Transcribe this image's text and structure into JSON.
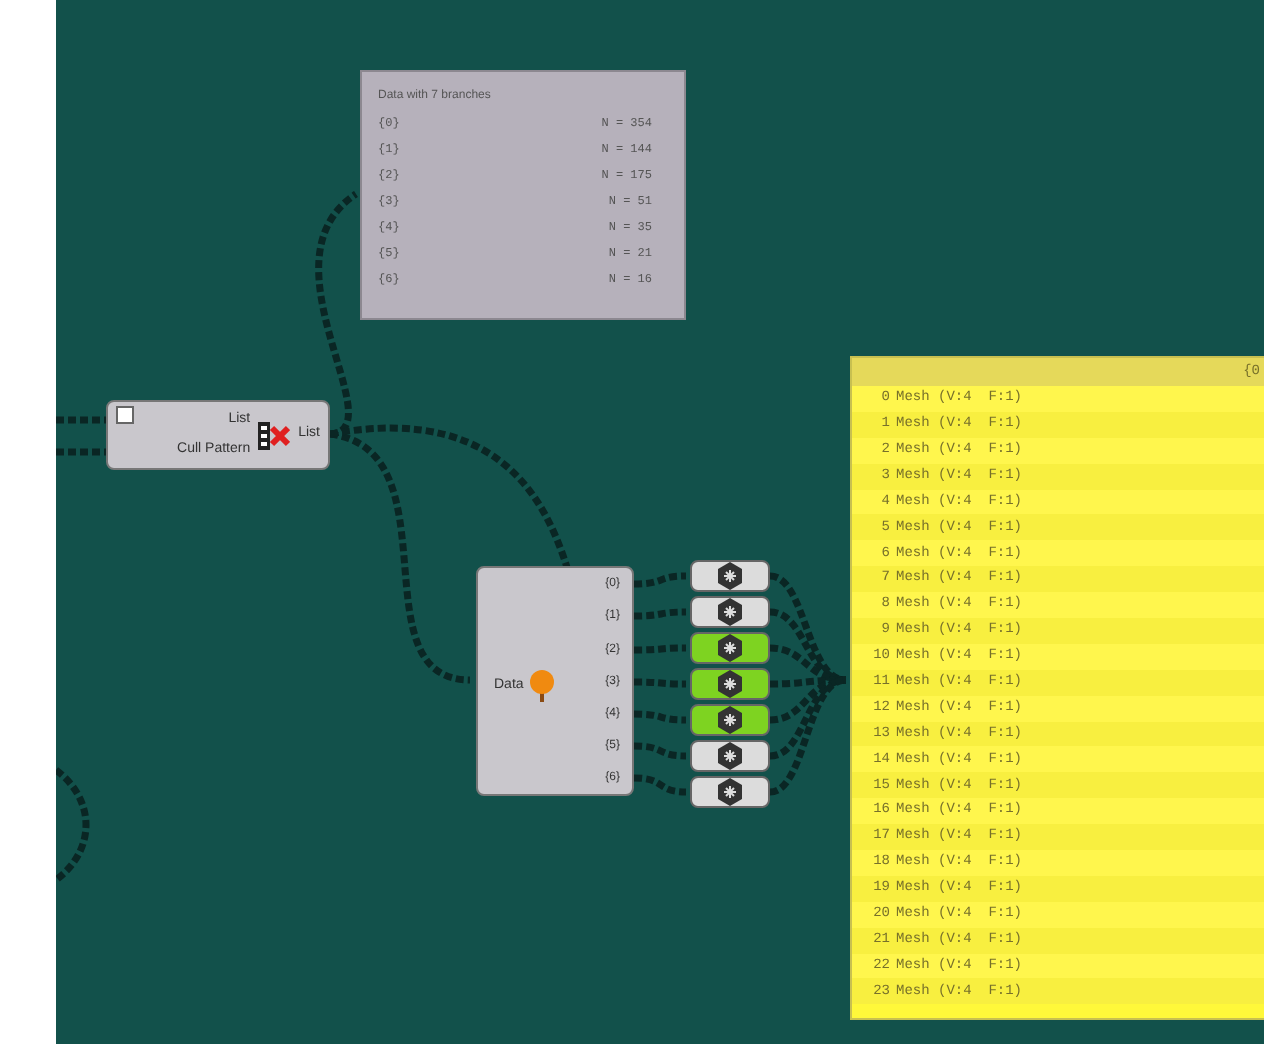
{
  "branch_panel": {
    "title": "Data with 7 branches",
    "rows": [
      {
        "path": "{0}",
        "count": "N = 354"
      },
      {
        "path": "{1}",
        "count": "N = 144"
      },
      {
        "path": "{2}",
        "count": "N = 175"
      },
      {
        "path": "{3}",
        "count": "N = 51"
      },
      {
        "path": "{4}",
        "count": "N = 35"
      },
      {
        "path": "{5}",
        "count": "N = 21"
      },
      {
        "path": "{6}",
        "count": "N = 16"
      }
    ]
  },
  "cull_node": {
    "inputs": [
      "List",
      "Cull Pattern"
    ],
    "output": "List"
  },
  "explode_node": {
    "input": "Data",
    "outputs": [
      "{0}",
      "{1}",
      "{2}",
      "{3}",
      "{4}",
      "{5}",
      "{6}"
    ]
  },
  "mesh_previews": [
    {
      "active": false
    },
    {
      "active": false
    },
    {
      "active": true
    },
    {
      "active": true
    },
    {
      "active": true
    },
    {
      "active": false
    },
    {
      "active": false
    }
  ],
  "mesh_panel": {
    "header": "{0",
    "rows": [
      {
        "index": "0",
        "value": "Mesh (V:4  F:1)"
      },
      {
        "index": "1",
        "value": "Mesh (V:4  F:1)"
      },
      {
        "index": "2",
        "value": "Mesh (V:4  F:1)"
      },
      {
        "index": "3",
        "value": "Mesh (V:4  F:1)"
      },
      {
        "index": "4",
        "value": "Mesh (V:4  F:1)"
      },
      {
        "index": "5",
        "value": "Mesh (V:4  F:1)"
      },
      {
        "index": "6",
        "value": "Mesh (V:4  F:1)"
      },
      {
        "index": "7",
        "value": "Mesh (V:4  F:1)"
      },
      {
        "index": "8",
        "value": "Mesh (V:4  F:1)"
      },
      {
        "index": "9",
        "value": "Mesh (V:4  F:1)"
      },
      {
        "index": "10",
        "value": "Mesh (V:4  F:1)"
      },
      {
        "index": "11",
        "value": "Mesh (V:4  F:1)"
      },
      {
        "index": "12",
        "value": "Mesh (V:4  F:1)"
      },
      {
        "index": "13",
        "value": "Mesh (V:4  F:1)"
      },
      {
        "index": "14",
        "value": "Mesh (V:4  F:1)"
      },
      {
        "index": "15",
        "value": "Mesh (V:4  F:1)"
      },
      {
        "index": "16",
        "value": "Mesh (V:4  F:1)"
      },
      {
        "index": "17",
        "value": "Mesh (V:4  F:1)"
      },
      {
        "index": "18",
        "value": "Mesh (V:4  F:1)"
      },
      {
        "index": "19",
        "value": "Mesh (V:4  F:1)"
      },
      {
        "index": "20",
        "value": "Mesh (V:4  F:1)"
      },
      {
        "index": "21",
        "value": "Mesh (V:4  F:1)"
      },
      {
        "index": "22",
        "value": "Mesh (V:4  F:1)"
      },
      {
        "index": "23",
        "value": "Mesh (V:4  F:1)"
      }
    ]
  }
}
